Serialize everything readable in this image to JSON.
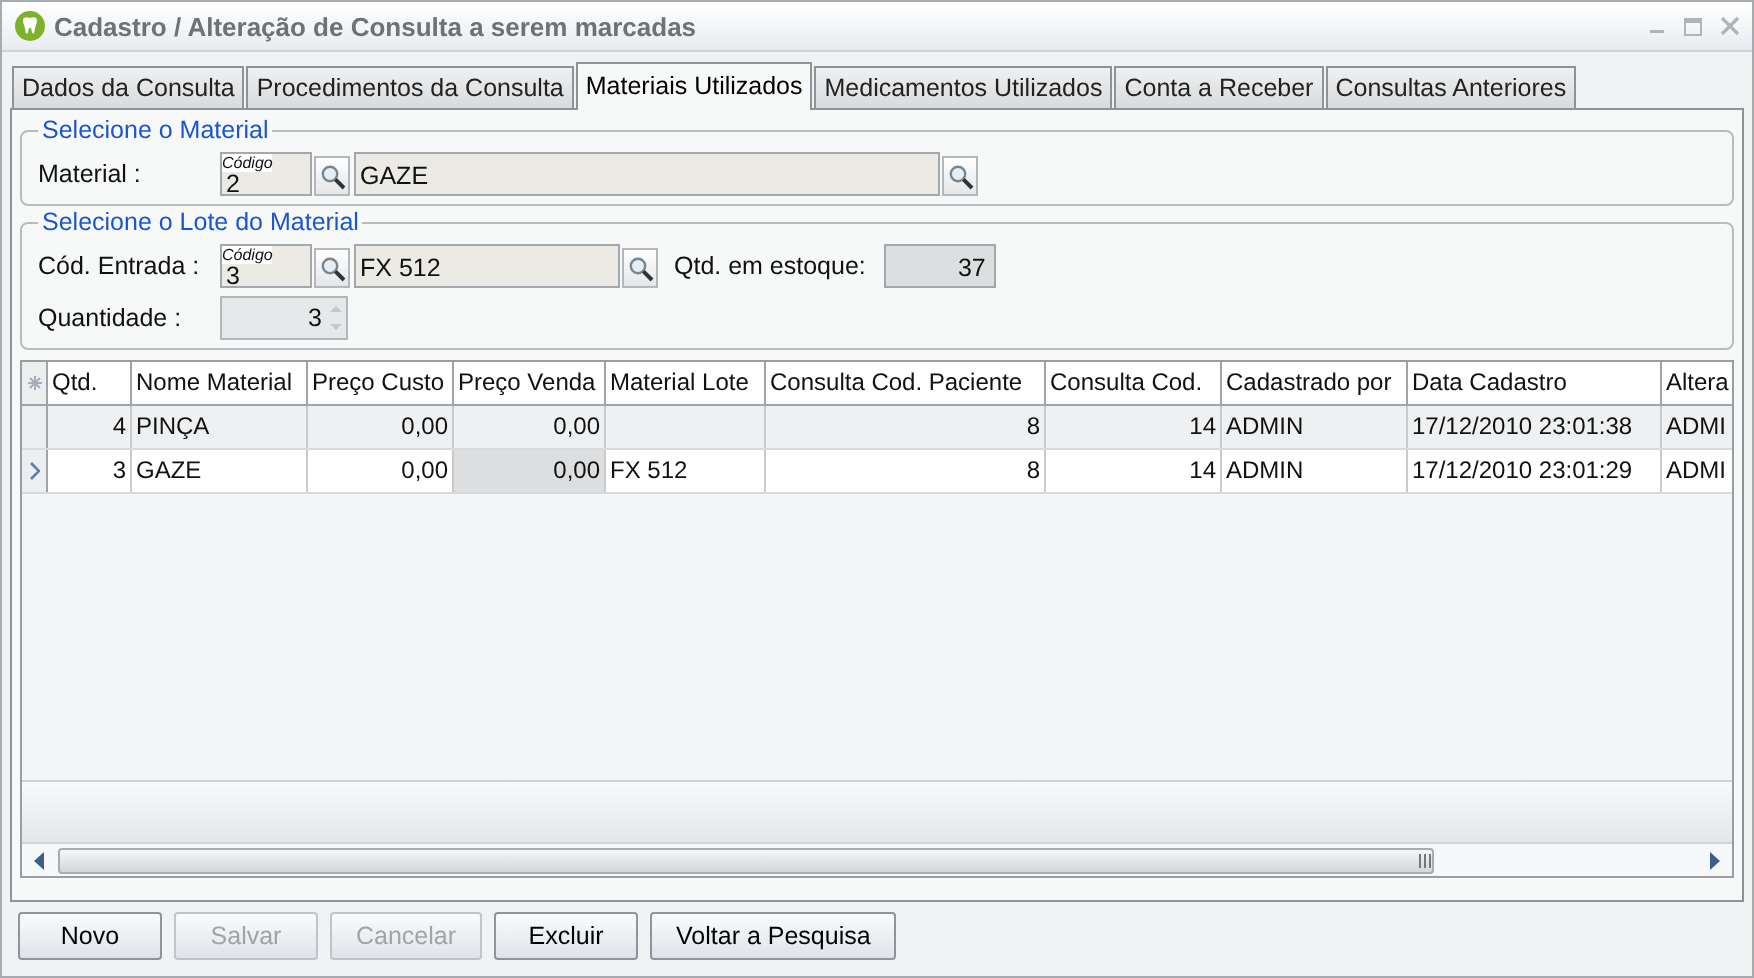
{
  "window": {
    "title": "Cadastro / Alteração de Consulta a serem marcadas"
  },
  "tabs": [
    {
      "label": "Dados da Consulta",
      "selected": false
    },
    {
      "label": "Procedimentos da Consulta",
      "selected": false
    },
    {
      "label": "Materiais Utilizados",
      "selected": true
    },
    {
      "label": "Medicamentos Utilizados",
      "selected": false
    },
    {
      "label": "Conta a Receber",
      "selected": false
    },
    {
      "label": "Consultas Anteriores",
      "selected": false
    }
  ],
  "material_group": {
    "title": "Selecione o Material",
    "label": "Material :",
    "code_caption": "Código",
    "code": "2",
    "name": "GAZE"
  },
  "lot_group": {
    "title": "Selecione o Lote do Material",
    "label": "Cód. Entrada :",
    "code_caption": "Código",
    "code": "3",
    "lot": "FX 512",
    "stock_label": "Qtd. em estoque:",
    "stock": "37",
    "quantity_label": "Quantidade :",
    "quantity": "3"
  },
  "table": {
    "columns": [
      "Qtd.",
      "Nome Material",
      "Preço Custo",
      "Preço Venda",
      "Material Lote",
      "Consulta Cod. Paciente",
      "Consulta Cod.",
      "Cadastrado por",
      "Data Cadastro",
      "Altera"
    ],
    "rows": [
      {
        "selected": false,
        "cells": [
          {
            "text": "4",
            "focused": false
          },
          {
            "text": "PINÇA",
            "focused": false
          },
          {
            "text": "0,00",
            "focused": false
          },
          {
            "text": "0,00",
            "focused": false
          },
          {
            "focused": false
          },
          {
            "text": "8",
            "focused": false
          },
          {
            "text": "14",
            "focused": false
          },
          {
            "text": "ADMIN",
            "focused": false
          },
          {
            "text": "17/12/2010 23:01:38",
            "focused": false
          },
          {
            "text": "ADMI",
            "focused": false
          }
        ]
      },
      {
        "selected": true,
        "cells": [
          {
            "text": "3",
            "focused": false
          },
          {
            "text": "GAZE",
            "focused": false
          },
          {
            "text": "0,00",
            "focused": false
          },
          {
            "text": "0,00",
            "focused": true
          },
          {
            "text": "FX 512",
            "focused": false
          },
          {
            "text": "8",
            "focused": false
          },
          {
            "text": "14",
            "focused": false
          },
          {
            "text": "ADMIN",
            "focused": false
          },
          {
            "text": "17/12/2010 23:01:29",
            "focused": false
          },
          {
            "text": "ADMI",
            "focused": false
          }
        ]
      }
    ]
  },
  "buttons": [
    {
      "label": "Novo",
      "disabled": false
    },
    {
      "label": "Salvar",
      "disabled": true
    },
    {
      "label": "Cancelar",
      "disabled": true
    },
    {
      "label": "Excluir",
      "disabled": false
    },
    {
      "label": "Voltar a Pesquisa",
      "disabled": false
    }
  ]
}
